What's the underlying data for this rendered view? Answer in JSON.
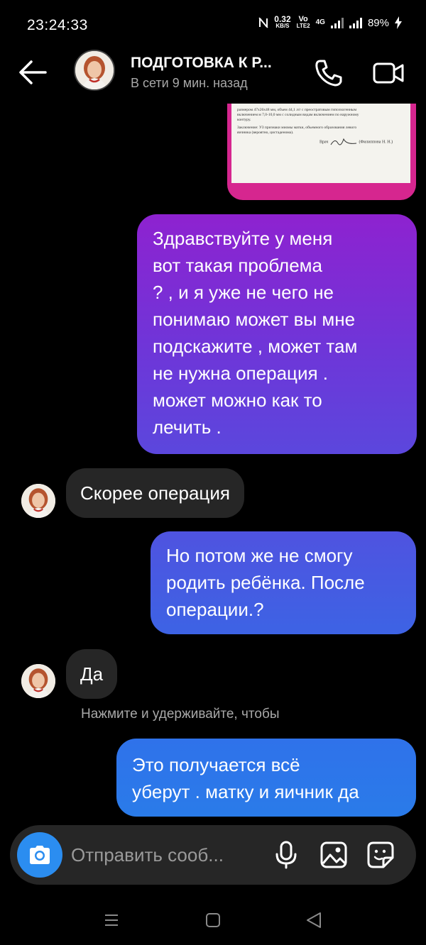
{
  "status_bar": {
    "time": "23:24:33",
    "net_speed_value": "0.32",
    "net_speed_unit": "KB/S",
    "volte_top": "Vo",
    "volte_bottom": "LTE2",
    "network_type": "4G",
    "battery": "89%"
  },
  "header": {
    "title": "ПОДГОТОВКА К Р...",
    "subtitle": "В сети 9 мин. назад"
  },
  "document_image": {
    "text_lines": [
      "размером 47х26х48 мм, объем 44,1 л/г с преостратовым гипоэхогенным",
      "включением м 7,0-10,0 мм с солидным видам включением по наружному",
      "контуру.",
      "Заключение: УЗ признаки миомы матки, объемного образования левого",
      "яичника (вероятно, цистаденома)."
    ],
    "signature_label": "Врач",
    "signature_name": "(Филиппова Н. Н.)"
  },
  "messages": [
    {
      "direction": "out",
      "lines": [
        "Здравствуйте у меня",
        "вот такая проблема",
        "? , и я уже не чего не",
        "понимаю может вы мне",
        "подскажите , может там",
        "не нужна операция .",
        "может можно как то",
        "лечить ."
      ]
    },
    {
      "direction": "in",
      "lines": [
        "Скорее операция"
      ]
    },
    {
      "direction": "out",
      "lines": [
        "Но потом же не смогу",
        "родить ребёнка. После",
        "операции.?"
      ]
    },
    {
      "direction": "in",
      "lines": [
        "Да"
      ]
    },
    {
      "direction": "out",
      "lines": [
        "Это получается всё",
        "уберут . матку и яичник  да"
      ]
    }
  ],
  "hint_text": "Нажмите и удерживайте, чтобы",
  "composer": {
    "placeholder": "Отправить сооб...",
    "camera_icon": "camera-icon",
    "mic_icon": "microphone-icon",
    "gallery_icon": "gallery-icon",
    "sticker_icon": "sticker-icon"
  },
  "colors": {
    "background": "#000000",
    "incoming_bubble": "#262626",
    "outgoing_gradient_top": "#8e22d0",
    "outgoing_gradient_bottom": "#2a7be9",
    "camera_button": "#2b8df0",
    "document_frame": "#d6268f"
  }
}
